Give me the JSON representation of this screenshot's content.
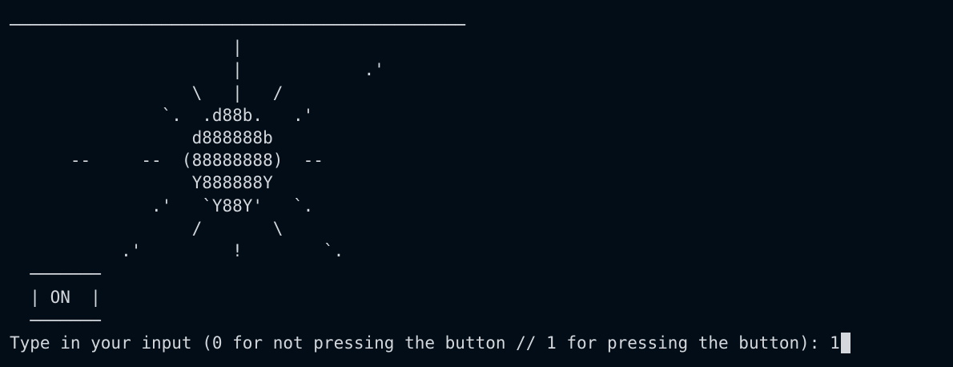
{
  "terminal": {
    "bulb_art": "─────────────────────────────────────────────\n                      |\n                      |            .'\n                  \\   |   /\n               `.  .d88b.   .'\n                  d888888b\n      --     --  (88888888)  --\n                  Y888888Y\n              .'   `Y88Y'   `.\n                  /       \\\n           .'         !        `.",
    "switch_art": "  ───────\n  | ON  |\n  ───────",
    "prompt_text": "Type in your input (0 for not pressing the button // 1 for pressing the button): ",
    "input_value": "1"
  },
  "colors": {
    "background": "#020d17",
    "foreground": "#d4d8dc"
  }
}
